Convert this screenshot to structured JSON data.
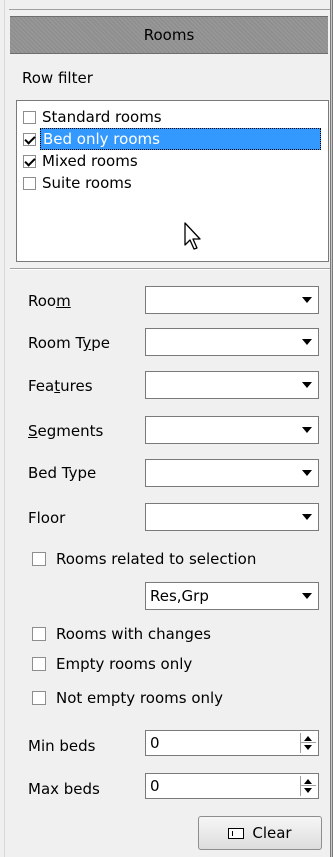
{
  "header": {
    "title": "Rooms"
  },
  "row_filter": {
    "label": "Row filter",
    "items": [
      {
        "label": "Standard rooms",
        "checked": false,
        "selected": false
      },
      {
        "label": "Bed only rooms",
        "checked": true,
        "selected": true
      },
      {
        "label": "Mixed rooms",
        "checked": true,
        "selected": false
      },
      {
        "label": "Suite rooms",
        "checked": false,
        "selected": false
      }
    ]
  },
  "fields": {
    "room": {
      "label_pre": "Roo",
      "label_u": "m",
      "label_post": "",
      "value": ""
    },
    "room_type": {
      "label_pre": "Room T",
      "label_u": "y",
      "label_post": "pe",
      "value": ""
    },
    "features": {
      "label_pre": "Fea",
      "label_u": "t",
      "label_post": "ures",
      "value": ""
    },
    "segments": {
      "label_pre": "",
      "label_u": "S",
      "label_post": "egments",
      "value": ""
    },
    "bed_type": {
      "label": "Bed Type",
      "value": ""
    },
    "floor": {
      "label": "Floor",
      "value": ""
    }
  },
  "related": {
    "label": "Rooms related to selection",
    "checked": false,
    "combo_value": "Res,Grp"
  },
  "options": {
    "with_changes": {
      "label": "Rooms with changes",
      "checked": false
    },
    "empty_only": {
      "label": "Empty rooms only",
      "checked": false
    },
    "not_empty_only": {
      "label": "Not empty rooms only",
      "checked": false
    }
  },
  "min_beds": {
    "label": "Min beds",
    "value": "0"
  },
  "max_beds": {
    "label": "Max beds",
    "value": "0"
  },
  "clear_button": {
    "label": "Clear"
  },
  "colors": {
    "header_bg": "#8f8f8f",
    "selection": "#3399ff"
  }
}
